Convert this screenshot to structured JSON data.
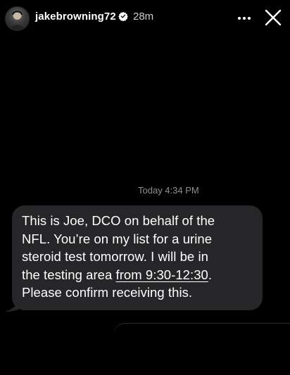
{
  "story": {
    "username": "jakebrowning72",
    "posted_ago": "28m",
    "verified": true
  },
  "header_icons": {
    "avatar": "profile-avatar",
    "verified": "verified-badge-icon",
    "more": "more-icon",
    "close": "close-icon"
  },
  "message": {
    "time_label": "Today 4:34 PM",
    "lines": [
      "This is Joe, DCO on behalf of the",
      "NFL. You’re on my list for a urine",
      "steroid test tomorrow. I will be in"
    ],
    "line4_before_link": "the testing area ",
    "line4_link": "from 9:30-12:30",
    "line4_after_link": ".",
    "line5": "Please confirm receiving this."
  },
  "colors": {
    "background": "#000000",
    "bubble": "#262628",
    "timestamp_gray": "#8e8e93",
    "text_white": "#ffffff"
  }
}
